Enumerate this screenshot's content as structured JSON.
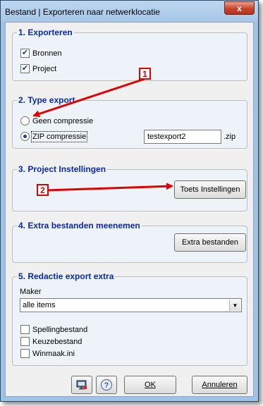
{
  "window": {
    "title": "Bestand | Exporteren naar netwerklocatie",
    "close_glyph": "x"
  },
  "sections": {
    "exporteren": {
      "legend": "1. Exporteren",
      "items": [
        {
          "label": "Bronnen",
          "checked": true
        },
        {
          "label": "Project",
          "checked": true
        }
      ]
    },
    "type_export": {
      "legend": "2. Type export",
      "options": [
        {
          "label": "Geen compressie",
          "selected": false
        },
        {
          "label": "ZIP compressie",
          "selected": true
        }
      ],
      "filename_value": "testexport2",
      "extension": ".zip"
    },
    "project_instellingen": {
      "legend": "3. Project Instellingen",
      "button_label": "Toets Instellingen"
    },
    "extra_bestanden": {
      "legend": "4. Extra bestanden meenemen",
      "button_label": "Extra bestanden"
    },
    "redactie": {
      "legend": "5. Redactie export extra",
      "maker_label": "Maker",
      "maker_selected": "alle items",
      "items": [
        {
          "label": "Spellingbestand",
          "checked": false
        },
        {
          "label": "Keuzebestand",
          "checked": false
        },
        {
          "label": "Winmaak.ini",
          "checked": false
        }
      ]
    }
  },
  "footer": {
    "ok_label": "OK",
    "cancel_label": "Annuleren"
  },
  "annotations": {
    "callout_1": "1",
    "callout_2": "2"
  },
  "colors": {
    "legend": "#0a2aa8",
    "annotation": "#e00000",
    "frame": "#9fc3e6"
  },
  "icons": [
    "close-icon",
    "checkmark-icon",
    "radio-dot-icon",
    "dropdown-arrow-icon",
    "monitor-icon",
    "help-icon"
  ]
}
